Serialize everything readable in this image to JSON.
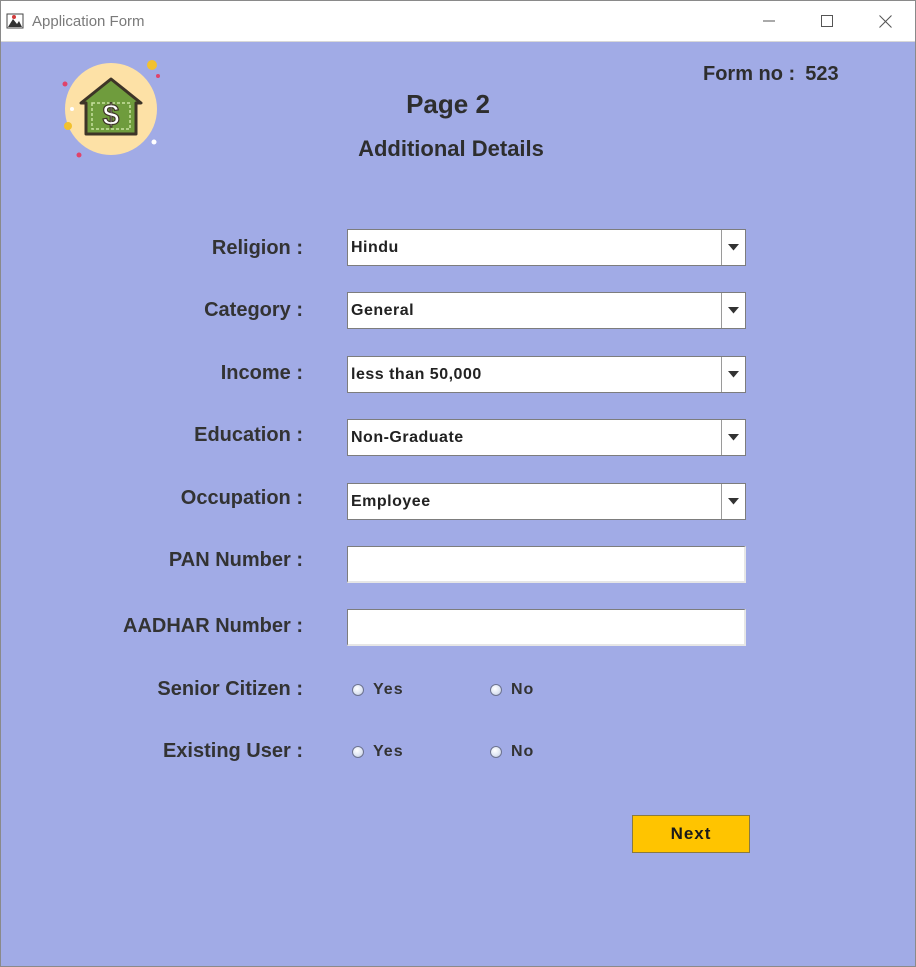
{
  "window": {
    "title": "Application Form"
  },
  "header": {
    "form_no_label": "Form no :",
    "form_no_value": "523",
    "page_title": "Page 2",
    "subtitle": "Additional Details"
  },
  "fields": {
    "religion": {
      "label": "Religion :",
      "value": "Hindu"
    },
    "category": {
      "label": "Category :",
      "value": "General"
    },
    "income": {
      "label": "Income :",
      "value": "less than 50,000"
    },
    "education": {
      "label": "Education :",
      "value": "Non-Graduate"
    },
    "occupation": {
      "label": "Occupation :",
      "value": "Employee"
    },
    "pan": {
      "label": "PAN Number :",
      "value": ""
    },
    "aadhar": {
      "label": "AADHAR Number :",
      "value": ""
    },
    "senior_citizen": {
      "label": "Senior Citizen :",
      "yes": "Yes",
      "no": "No"
    },
    "existing_user": {
      "label": "Existing User :",
      "yes": "Yes",
      "no": "No"
    }
  },
  "actions": {
    "next_label": "Next"
  },
  "colors": {
    "background": "#a1abe6",
    "next_button": "#ffc400",
    "logo_circle": "#fde1a6",
    "logo_house": "#6f9c3d"
  },
  "icons": {
    "app": "app-icon",
    "logo": "money-house-icon",
    "minimize": "minimize-icon",
    "maximize": "maximize-icon",
    "close": "close-icon",
    "dropdown": "chevron-down-icon"
  }
}
